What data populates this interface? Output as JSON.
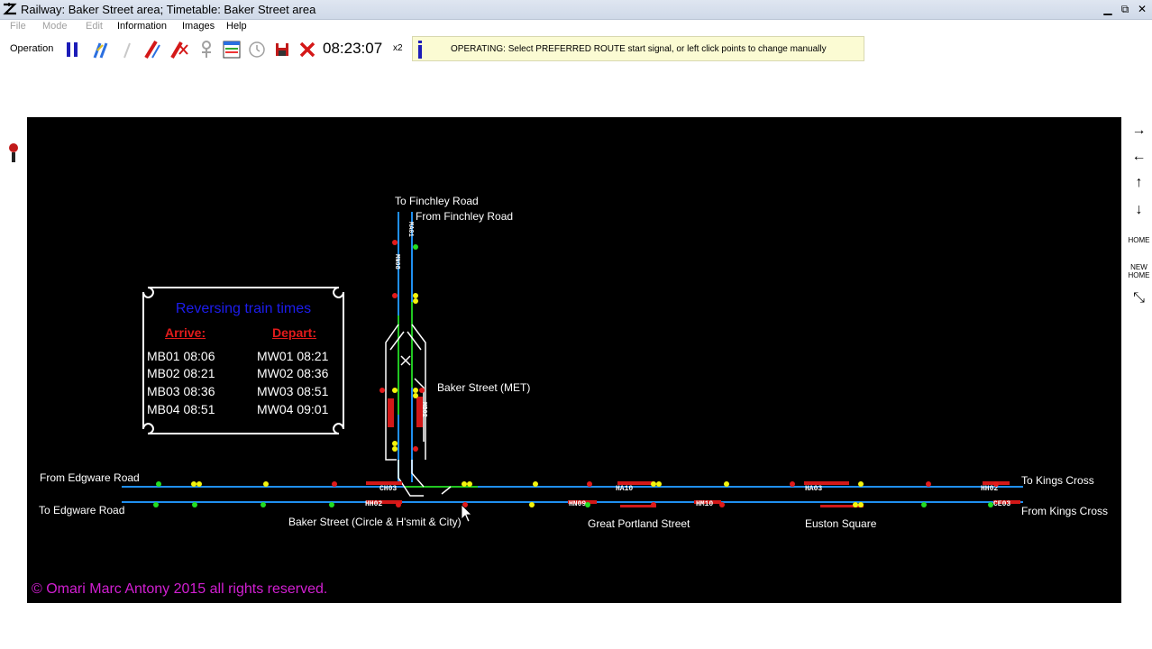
{
  "window": {
    "title": "Railway: Baker Street area; Timetable: Baker Street area",
    "minimize": "▁",
    "restore": "⧉",
    "close": "✕"
  },
  "menu": {
    "file": "File",
    "mode": "Mode",
    "edit": "Edit",
    "information": "Information",
    "images": "Images",
    "help": "Help"
  },
  "toolbar": {
    "mode_label": "Operation",
    "clock": "08:23:07",
    "speed": "x2",
    "status": "OPERATING:  Select PREFERRED ROUTE start signal, or left click points to change manually",
    "icons": [
      "pause-icon",
      "route-icon",
      "blank-icon",
      "red-pencil-icon",
      "red-cross-pencil-icon",
      "person-icon",
      "timetable-icon",
      "clock-icon",
      "save-icon",
      "exit-icon",
      "info-icon"
    ]
  },
  "colors": {
    "track": "#1f8ff0",
    "route_set": "#21c621",
    "train": "#d31818",
    "signal_red": "#e11a1a",
    "signal_yellow": "#f4f40c",
    "signal_green": "#22dd22",
    "copyright": "#d21fd2",
    "reversing_title": "#1d1dee"
  },
  "layout_labels": {
    "to_finchley": "To Finchley Road",
    "from_finchley": "From Finchley Road",
    "baker_met": "Baker Street (MET)",
    "from_edgware": "From Edgware Road",
    "to_edgware": "To Edgware Road",
    "to_kings": "To Kings Cross",
    "from_kings": "From Kings Cross",
    "baker_circle": "Baker Street  (Circle & H'smit & City)",
    "great_portland": "Great Portland Street",
    "euston": "Euston Square"
  },
  "trains": [
    "CH03",
    "HH02",
    "HN09",
    "HA10",
    "HM10",
    "HA03",
    "HH02",
    "CE03",
    "MA01",
    "MN08",
    "MB02"
  ],
  "reversing": {
    "title": "Reversing train times",
    "arrive": "Arrive:",
    "depart": "Depart:",
    "rows": [
      {
        "arr": "MB01  08:06",
        "dep": "MW01  08:21"
      },
      {
        "arr": "MB02  08:21",
        "dep": "MW02  08:36"
      },
      {
        "arr": "MB03  08:36",
        "dep": "MW03  08:51"
      },
      {
        "arr": "MB04  08:51",
        "dep": "MW04  09:01"
      }
    ]
  },
  "copyright": "© Omari Marc Antony 2015 all rights reserved.",
  "side_tools": {
    "right": "→",
    "left": "←",
    "up": "↑",
    "down": "↓",
    "home": "HOME",
    "new_home": "NEW HOME",
    "zoom": "⤡"
  }
}
